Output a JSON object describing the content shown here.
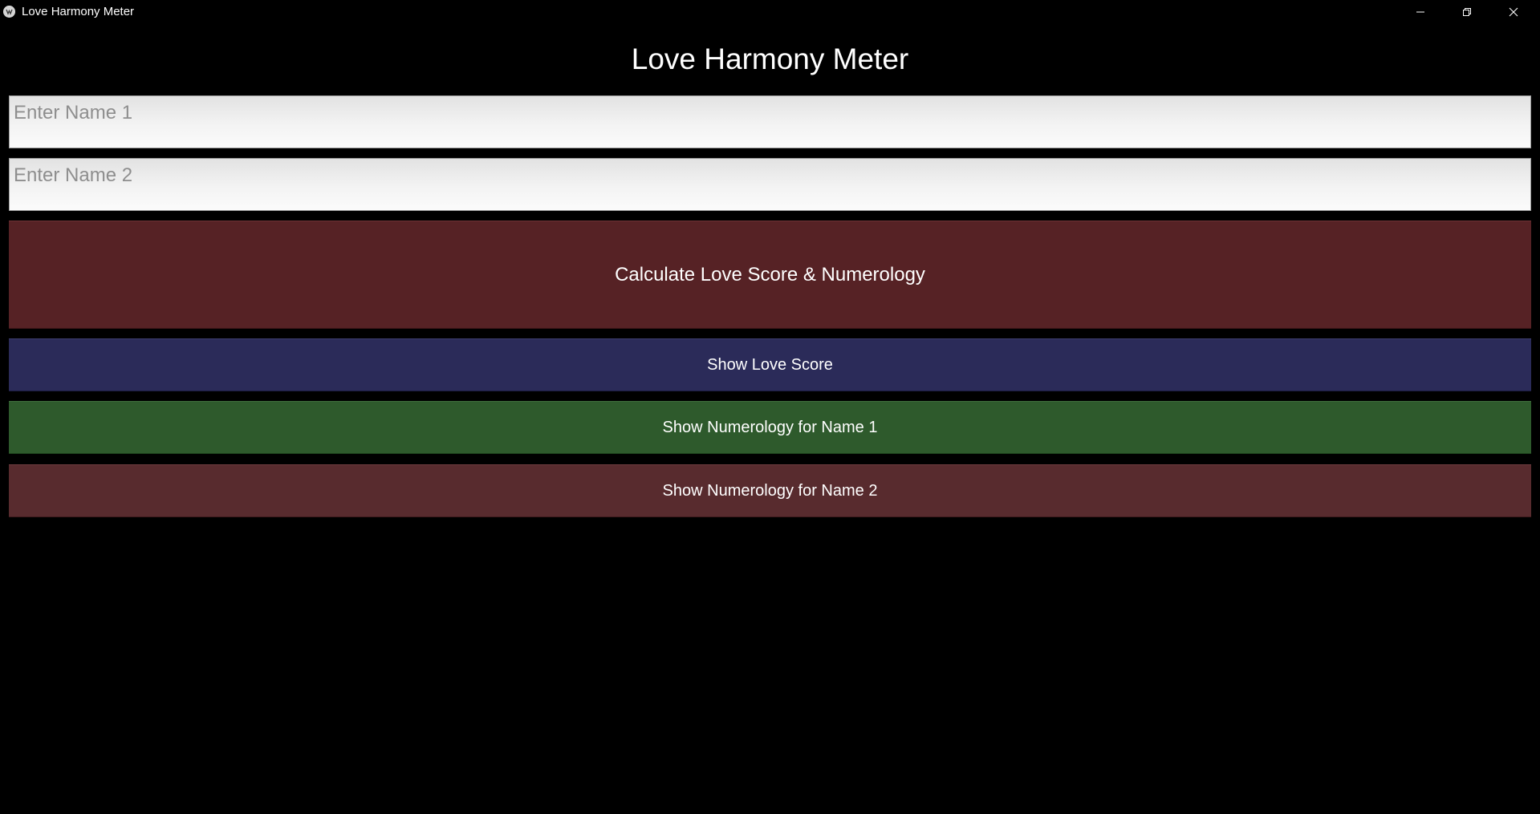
{
  "window": {
    "title": "Love Harmony Meter",
    "icon": "kivy-app-icon",
    "controls": {
      "minimize_icon": "minimize-icon",
      "maximize_icon": "restore-icon",
      "close_icon": "close-icon"
    }
  },
  "main": {
    "heading": "Love Harmony Meter",
    "name1": {
      "value": "",
      "placeholder": "Enter Name 1"
    },
    "name2": {
      "value": "",
      "placeholder": "Enter Name 2"
    },
    "buttons": {
      "calculate": {
        "label": "Calculate Love Score & Numerology",
        "color": "#562225"
      },
      "show_love_score": {
        "label": "Show Love Score",
        "color": "#2b2b59"
      },
      "show_numerology_1": {
        "label": "Show Numerology for Name 1",
        "color": "#2e5a2c"
      },
      "show_numerology_2": {
        "label": "Show Numerology for Name 2",
        "color": "#582b2e"
      }
    }
  },
  "colors": {
    "background": "#000000",
    "text": "#ffffff"
  }
}
